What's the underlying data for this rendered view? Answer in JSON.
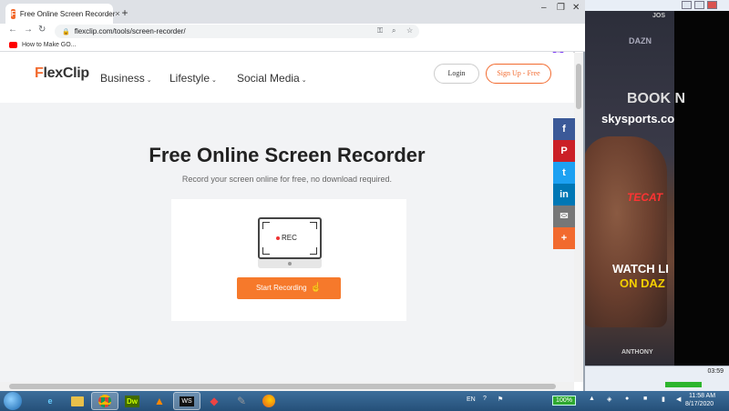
{
  "browser": {
    "tab_title": "Free Online Screen Recorder",
    "tab_close": "×",
    "new_tab": "+",
    "favicon": "F",
    "url": "flexclip.com/tools/screen-recorder/",
    "avatar_letter": "E",
    "bookmark": "How to Make GO..."
  },
  "site": {
    "logo_prefix": "F",
    "logo_rest": "lexClip",
    "nav": [
      "Business",
      "Lifestyle",
      "Social Media"
    ],
    "login": "Login",
    "signup": "Sign Up - Free"
  },
  "hero": {
    "title": "Free Online Screen Recorder",
    "subtitle": "Record your screen online for free, no download required.",
    "rec_label": "REC",
    "button": "Start Recording"
  },
  "share": [
    {
      "icon": "facebook-icon",
      "glyph": "f",
      "color": "#3b5998"
    },
    {
      "icon": "pinterest-icon",
      "glyph": "P",
      "color": "#cb2027"
    },
    {
      "icon": "twitter-icon",
      "glyph": "t",
      "color": "#1da1f2"
    },
    {
      "icon": "linkedin-icon",
      "glyph": "in",
      "color": "#0077b5"
    },
    {
      "icon": "email-icon",
      "glyph": "✉",
      "color": "#777777"
    },
    {
      "icon": "more-icon",
      "glyph": "+",
      "color": "#f26a2e"
    }
  ],
  "video": {
    "dazn_top": "DAZN",
    "book": "BOOK N",
    "sky": "skysports.co",
    "tecate": "TECAT",
    "watch": "WATCH LI",
    "on": "ON DAZ",
    "anthony": "ANTHONY",
    "jos": "JOS",
    "time": "03:59"
  },
  "taskbar": {
    "battery": "100%",
    "time": "11:58 AM",
    "date": "8/17/2020"
  },
  "colors": {
    "accent": "#f26a2e",
    "button": "#f6792b"
  }
}
